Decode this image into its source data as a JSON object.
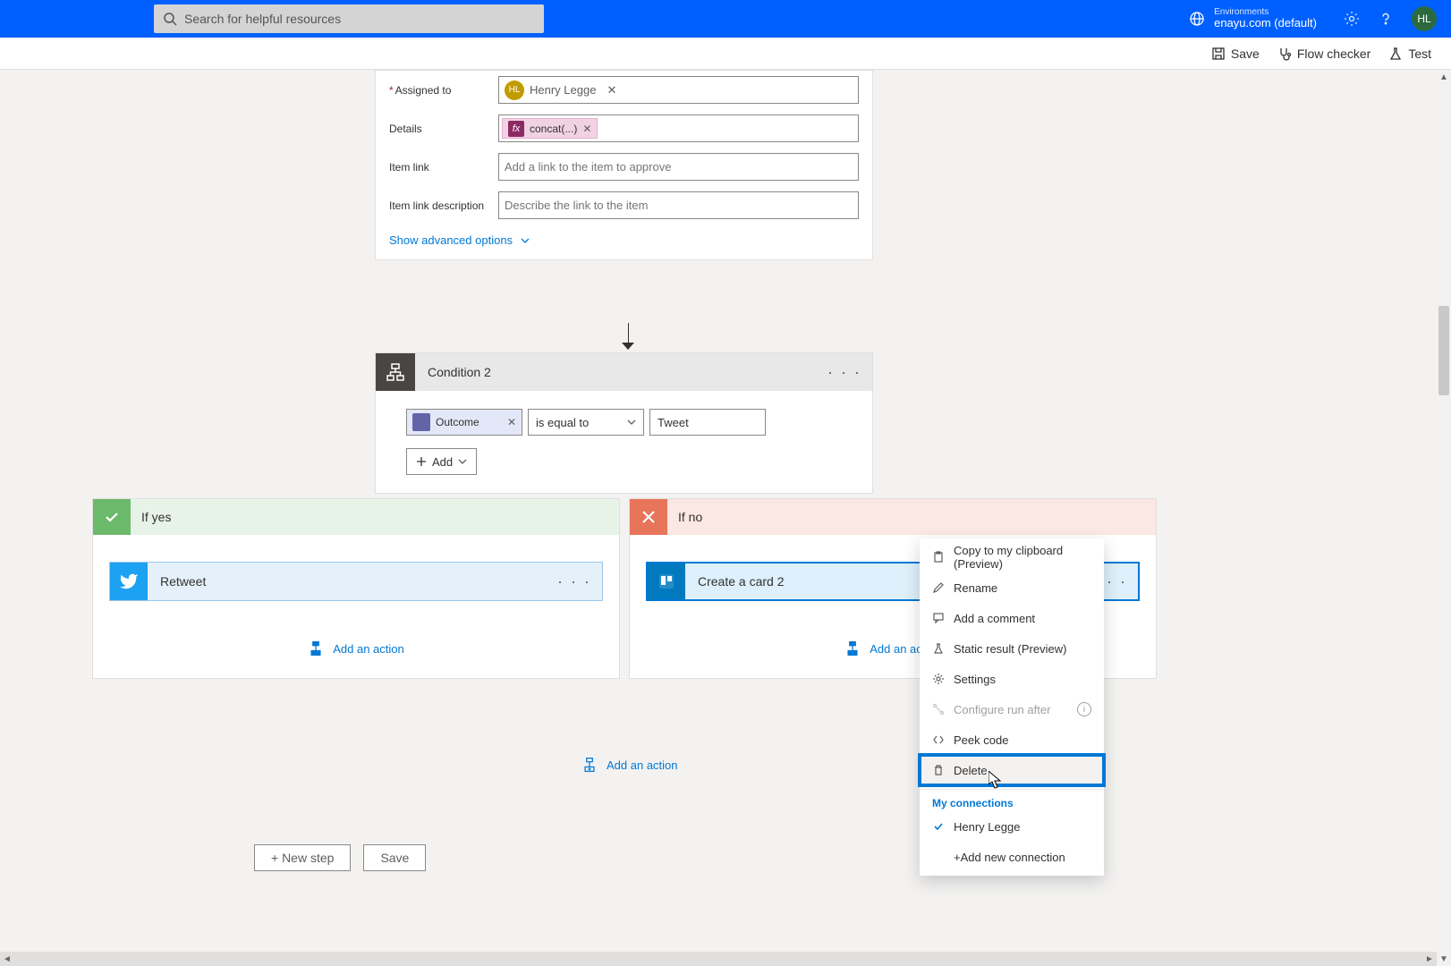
{
  "topbar": {
    "search_placeholder": "Search for helpful resources",
    "env_label": "Environments",
    "env_name": "enayu.com (default)",
    "avatar": "HL"
  },
  "toolbar": {
    "save": "Save",
    "checker": "Flow checker",
    "test": "Test"
  },
  "approval": {
    "assigned_label": "Assigned to",
    "assigned_name": "Henry Legge",
    "details_label": "Details",
    "details_token": "concat(...)",
    "link_label": "Item link",
    "link_placeholder": "Add a link to the item to approve",
    "linkdesc_label": "Item link description",
    "linkdesc_placeholder": "Describe the link to the item",
    "advanced": "Show advanced options"
  },
  "condition": {
    "title": "Condition 2",
    "outcome_label": "Outcome",
    "operator": "is equal to",
    "value": "Tweet",
    "add": "Add"
  },
  "branches": {
    "yes_title": "If yes",
    "no_title": "If no",
    "retweet": "Retweet",
    "createcard": "Create a card 2",
    "add_action": "Add an action"
  },
  "bottom": {
    "new_step": "+ New step",
    "save": "Save"
  },
  "ctx": {
    "copy": "Copy to my clipboard (Preview)",
    "rename": "Rename",
    "comment": "Add a comment",
    "static": "Static result (Preview)",
    "settings": "Settings",
    "runafter": "Configure run after",
    "peek": "Peek code",
    "delete": "Delete",
    "myconn": "My connections",
    "conn_user": "Henry Legge",
    "addconn": "+Add new connection"
  }
}
